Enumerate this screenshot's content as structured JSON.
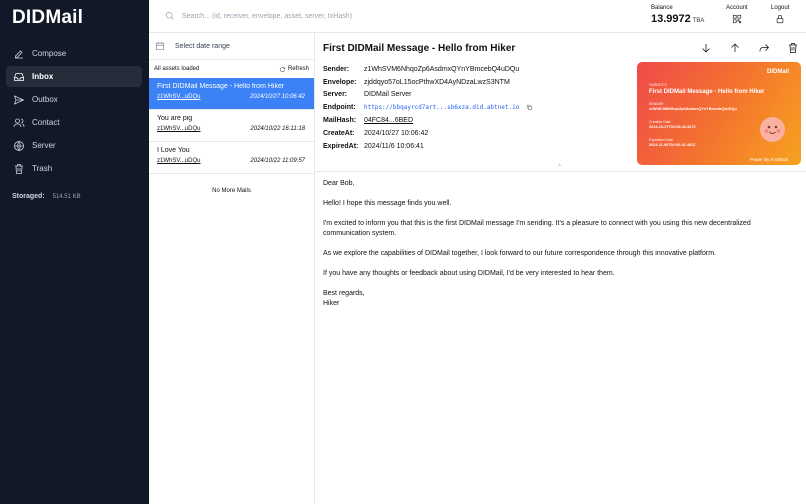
{
  "app": {
    "title": "DIDMail"
  },
  "sidebar": {
    "items": [
      {
        "label": "Compose",
        "icon": "compose-icon",
        "active": false
      },
      {
        "label": "Inbox",
        "icon": "inbox-icon",
        "active": true
      },
      {
        "label": "Outbox",
        "icon": "outbox-icon",
        "active": false
      },
      {
        "label": "Contact",
        "icon": "contact-icon",
        "active": false
      },
      {
        "label": "Server",
        "icon": "globe-icon",
        "active": false
      },
      {
        "label": "Trash",
        "icon": "trash-icon",
        "active": false
      }
    ],
    "storage_label": "Storaged:",
    "storage_value": "514.51 KB"
  },
  "topbar": {
    "search_placeholder": "Search... (id, receiver, envelope, asset, server, txHash)",
    "balance_label": "Balance",
    "balance_amount": "13.9972",
    "balance_unit": "TBA",
    "account_label": "Account",
    "logout_label": "Logout"
  },
  "list": {
    "date_placeholder": "Select date range",
    "filter_label": "All assets loaded",
    "refresh_label": "Refresh",
    "mails": [
      {
        "subject": "First DIDMail Message - Hello from Hiker",
        "sender": "z1WhSV...uDQu",
        "date": "2024/10/27 10:06:42",
        "selected": true
      },
      {
        "subject": "You are pig",
        "sender": "z1WhSV...uDQu",
        "date": "2024/10/22 16:11:18",
        "selected": false
      },
      {
        "subject": "I Love You",
        "sender": "z1WhSV...uDQu",
        "date": "2024/10/22 11:09:57",
        "selected": false
      }
    ],
    "no_more": "No More Mails"
  },
  "detail": {
    "title": "First DIDMail Message - Hello from Hiker",
    "fields": {
      "sender_label": "Sender:",
      "sender": "z1WhSVM6NhqoZp6AsdmxQYnYBmcebQ4uDQu",
      "envelope_label": "Envelope:",
      "envelope": "zjddqyo57oL15ocPthwXD4AyNDzaLwzS3NTM",
      "server_label": "Server:",
      "server": "DIDMail Server",
      "endpoint_label": "Endpoint:",
      "endpoint": "https://bbqayrcd7art...sb6xza.did.abtnet.io",
      "mailhash_label": "MailHash:",
      "mailhash": "04FC84...6BED",
      "createat_label": "CreateAt:",
      "createat": "2024/10/27 10:06:42",
      "expiredat_label": "ExpiredAt:",
      "expiredat": "2024/11/6 10:06:41"
    },
    "card": {
      "brand": "DIDMail",
      "subject_label": "SUBJECT",
      "subject": "First DIDMail Message - Hello from Hiker",
      "sender_label": "SENDER",
      "sender": "z1WhSVM6NhqoZp6AsdmxQYnYBmcebQ4uDQu",
      "creation_label": "Creation Date",
      "creation": "2024-10-27T02:06:42.347Z",
      "expiration_label": "Expiration Date",
      "expiration": "2024-11-06T02:06:41.461Z",
      "power": "Power By ArcBlock"
    },
    "body": {
      "greeting": "Dear Bob,",
      "p1": "Hello! I hope this message finds you well.",
      "p2": "I'm excited to inform you that this is the first DIDMail message I'm sending. It's a pleasure to connect with you using this new decentralized communication system.",
      "p3": "As we explore the capabilities of DIDMail together, I look forward to our future correspondence through this innovative platform.",
      "p4": "If you have any thoughts or feedback about using DIDMail, I'd be very interested to hear them.",
      "closing": "Best regards,",
      "signature": "Hiker"
    }
  },
  "colors": {
    "sidebar_bg": "#111827",
    "accent": "#3b82f6",
    "card_start": "#ef4a4a",
    "card_end": "#f7a21f"
  }
}
